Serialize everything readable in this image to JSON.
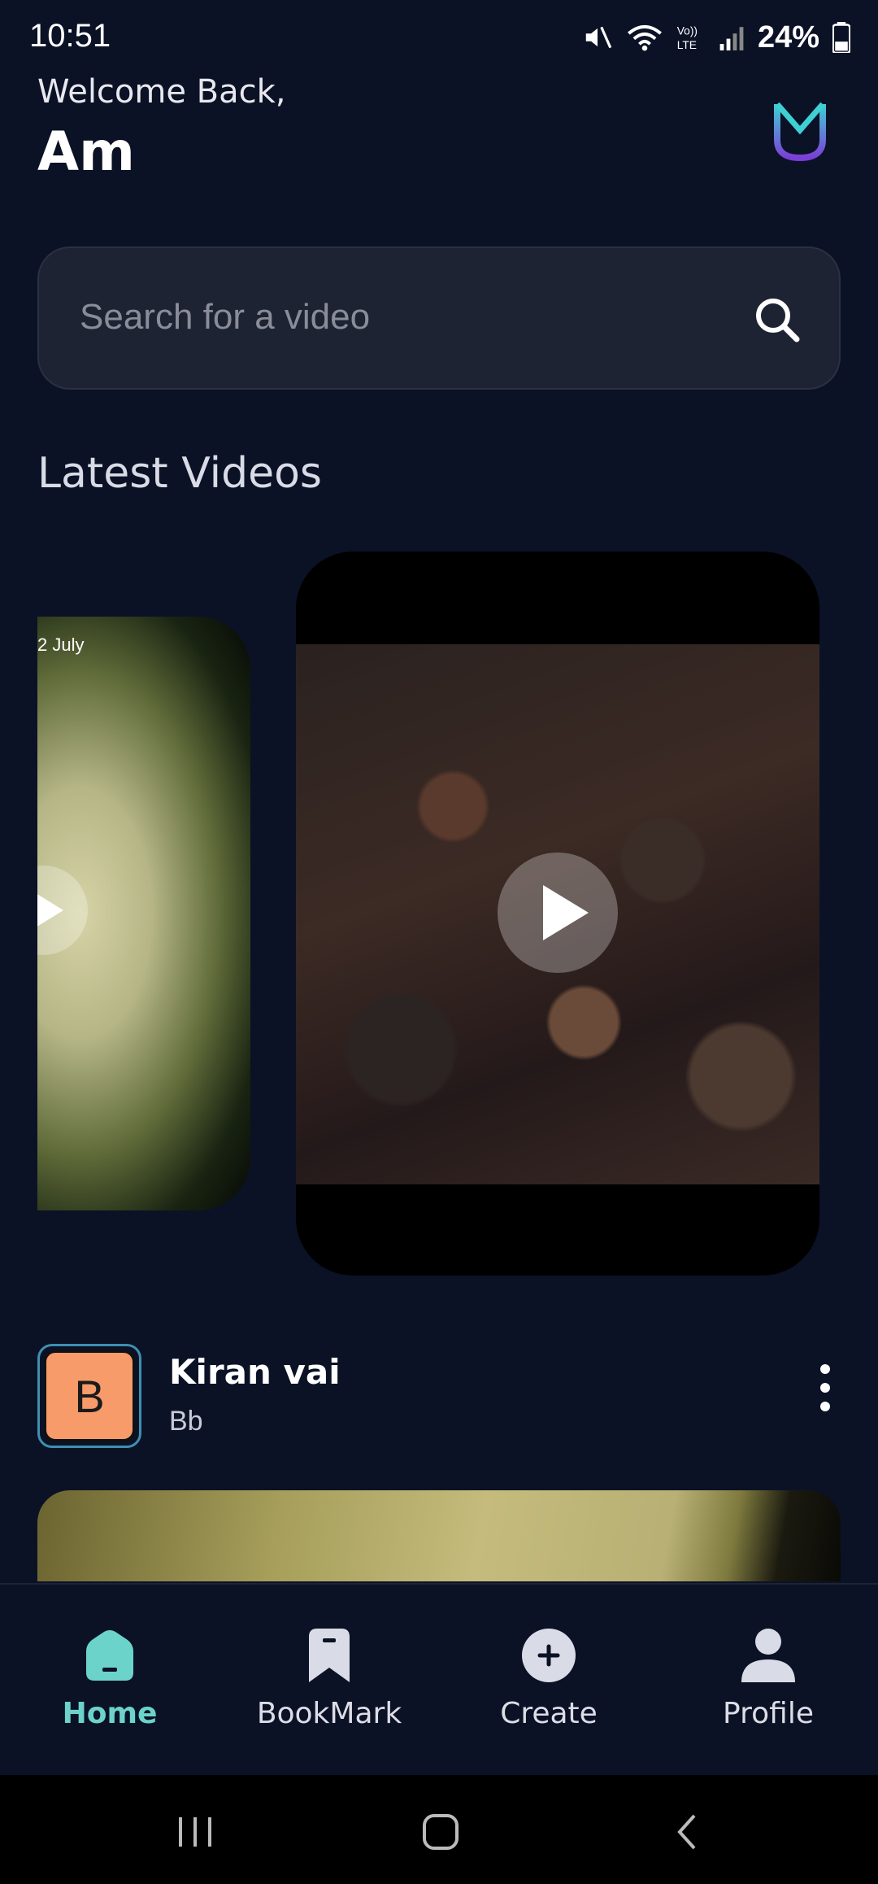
{
  "status_bar": {
    "time": "10:51",
    "battery": "24%",
    "icons": [
      "mute-icon",
      "wifi-icon",
      "volte-icon",
      "signal-icon",
      "battery-icon"
    ]
  },
  "header": {
    "welcome": "Welcome Back,",
    "username": "Am",
    "logo": "app-logo"
  },
  "search": {
    "placeholder": "Search for a video",
    "icon": "search-icon"
  },
  "latest": {
    "title": "Latest Videos",
    "cards": [
      {
        "date_fragment": "2 July"
      },
      {}
    ]
  },
  "post": {
    "avatar_letter": "B",
    "title": "Kiran vai",
    "subtitle": "Bb"
  },
  "bottom_nav": {
    "items": [
      {
        "label": "Home",
        "icon": "home-icon",
        "active": true
      },
      {
        "label": "BookMark",
        "icon": "bookmark-icon",
        "active": false
      },
      {
        "label": "Create",
        "icon": "plus-circle-icon",
        "active": false
      },
      {
        "label": "Profile",
        "icon": "profile-icon",
        "active": false
      }
    ]
  },
  "colors": {
    "background": "#0b1226",
    "accent": "#6cd3cb",
    "search_bg": "#1e2334",
    "avatar_bg": "#f79b6b"
  }
}
